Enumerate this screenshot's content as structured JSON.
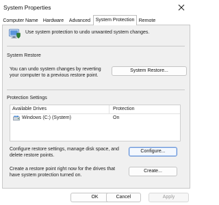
{
  "window": {
    "title": "System Properties"
  },
  "tabs": [
    {
      "label": "Computer Name"
    },
    {
      "label": "Hardware"
    },
    {
      "label": "Advanced"
    },
    {
      "label": "System Protection"
    },
    {
      "label": "Remote"
    }
  ],
  "intro_text": "Use system protection to undo unwanted system changes.",
  "system_restore": {
    "heading": "System Restore",
    "description_line1": "You can undo system changes by reverting",
    "description_line2": "your computer to a previous restore point.",
    "button_label": "System Restore..."
  },
  "protection_settings": {
    "heading": "Protection Settings",
    "columns": {
      "drives": "Available Drives",
      "protection": "Protection"
    },
    "rows": [
      {
        "drive": "Windows (C:) (System)",
        "protection": "On"
      }
    ]
  },
  "configure": {
    "description_line1": "Configure restore settings, manage disk space, and",
    "description_line2": "delete restore points.",
    "button_label": "Configure..."
  },
  "create": {
    "description_line1": "Create a restore point right now for the drives that",
    "description_line2": "have system protection turned on.",
    "button_label": "Create..."
  },
  "footer": {
    "ok_label": "OK",
    "cancel_label": "Cancel",
    "apply_label": "Apply"
  },
  "colors": {
    "accent": "#5b8bd6",
    "panel_bg": "#f0f0f0",
    "disabled_text": "#9a9a9a"
  }
}
